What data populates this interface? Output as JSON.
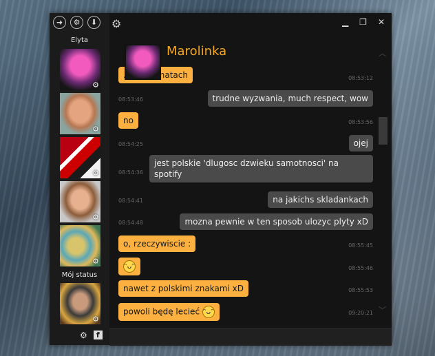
{
  "sidebar": {
    "section_favorites": "Elyta",
    "section_status": "Mój status"
  },
  "header": {
    "contact_name": "Marolinka"
  },
  "messages": [
    {
      "dir": "in",
      "text": "...ych tematach",
      "time": "08:53:12"
    },
    {
      "dir": "out",
      "text": "trudne wyzwania, much respect, wow",
      "time": "08:53:46"
    },
    {
      "dir": "in",
      "text": "no",
      "time": "08:53:56"
    },
    {
      "dir": "out",
      "text": "ojej",
      "time": "08:54:25"
    },
    {
      "dir": "out",
      "text": "jest polskie 'dlugosc dzwieku samotnosci' na spotify",
      "time": "08:54:36"
    },
    {
      "dir": "out",
      "text": "na jakichs skladankach",
      "time": "08:54:41"
    },
    {
      "dir": "out",
      "text": "mozna pewnie w ten sposob ulozyc plyty xD",
      "time": "08:54:48"
    },
    {
      "dir": "in",
      "text": "o, rzeczywiscie :",
      "time": "08:55:45"
    },
    {
      "dir": "in",
      "text": "",
      "time": "08:55:46"
    },
    {
      "dir": "in",
      "text": "nawet z polskimi znakami xD",
      "time": "08:55:53"
    },
    {
      "dir": "in",
      "text": "powoli będę lecieć",
      "time": "09:20:21"
    }
  ],
  "colors": {
    "accent": "#f5a623",
    "incoming": "#fbb040",
    "outgoing": "#4a4a4a"
  }
}
